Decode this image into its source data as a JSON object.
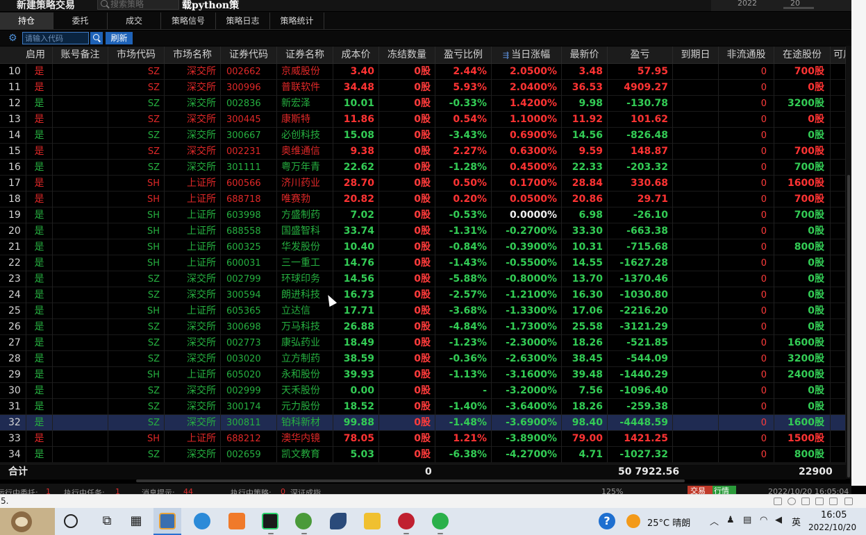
{
  "window": {
    "title": "新建策略交易",
    "search_placeholder": "搜索策略",
    "pane_title": "载python策",
    "date_year": "2022",
    "date_day": "20"
  },
  "tabs": [
    {
      "label": "持仓",
      "active": true
    },
    {
      "label": "委托",
      "active": false
    },
    {
      "label": "成交",
      "active": false
    },
    {
      "label": "策略信号",
      "active": false
    },
    {
      "label": "策略日志",
      "active": false
    },
    {
      "label": "策略统计",
      "active": false
    }
  ],
  "toolbar": {
    "code_placeholder": "请输入代码",
    "refresh_label": "刷新"
  },
  "columns": [
    "启用",
    "账号备注",
    "市场代码",
    "市场名称",
    "证券代码",
    "证券名称",
    "成本价",
    "冻结数量",
    "盈亏比例",
    "当日涨幅",
    "最新价",
    "盈亏",
    "到期日",
    "非流通股",
    "在途股份",
    "可用"
  ],
  "rows": [
    {
      "idx": "10",
      "use": "是",
      "mkt": "SZ",
      "mname": "深交所",
      "code": "002662",
      "name": "京威股份",
      "cost": "3.40",
      "frozen": "0股",
      "pct": "2.44%",
      "chg": "2.0500%",
      "last": "3.48",
      "pnl": "57.95",
      "expire": "",
      "nonc": "0",
      "transit": "700股",
      "dir": "up"
    },
    {
      "idx": "11",
      "use": "是",
      "mkt": "SZ",
      "mname": "深交所",
      "code": "300996",
      "name": "普联软件",
      "cost": "34.48",
      "frozen": "0股",
      "pct": "5.93%",
      "chg": "2.0400%",
      "last": "36.53",
      "pnl": "4909.27",
      "expire": "",
      "nonc": "0",
      "transit": "0股",
      "dir": "up"
    },
    {
      "idx": "12",
      "use": "是",
      "mkt": "SZ",
      "mname": "深交所",
      "code": "002836",
      "name": "新宏泽",
      "cost": "10.01",
      "frozen": "0股",
      "pct": "-0.33%",
      "chg": "1.4200%",
      "last": "9.98",
      "pnl": "-130.78",
      "expire": "",
      "nonc": "0",
      "transit": "3200股",
      "dir": "dn",
      "chgdir": "up"
    },
    {
      "idx": "13",
      "use": "是",
      "mkt": "SZ",
      "mname": "深交所",
      "code": "300445",
      "name": "康斯特",
      "cost": "11.86",
      "frozen": "0股",
      "pct": "0.54%",
      "chg": "1.1000%",
      "last": "11.92",
      "pnl": "101.62",
      "expire": "",
      "nonc": "0",
      "transit": "0股",
      "dir": "up"
    },
    {
      "idx": "14",
      "use": "是",
      "mkt": "SZ",
      "mname": "深交所",
      "code": "300667",
      "name": "必创科技",
      "cost": "15.08",
      "frozen": "0股",
      "pct": "-3.43%",
      "chg": "0.6900%",
      "last": "14.56",
      "pnl": "-826.48",
      "expire": "",
      "nonc": "0",
      "transit": "0股",
      "dir": "dn",
      "chgdir": "up"
    },
    {
      "idx": "15",
      "use": "是",
      "mkt": "SZ",
      "mname": "深交所",
      "code": "002231",
      "name": "奥维通信",
      "cost": "9.38",
      "frozen": "0股",
      "pct": "2.27%",
      "chg": "0.6300%",
      "last": "9.59",
      "pnl": "148.87",
      "expire": "",
      "nonc": "0",
      "transit": "700股",
      "dir": "up"
    },
    {
      "idx": "16",
      "use": "是",
      "mkt": "SZ",
      "mname": "深交所",
      "code": "301111",
      "name": "粤万年青",
      "cost": "22.62",
      "frozen": "0股",
      "pct": "-1.28%",
      "chg": "0.4500%",
      "last": "22.33",
      "pnl": "-203.32",
      "expire": "",
      "nonc": "0",
      "transit": "700股",
      "dir": "dn",
      "chgdir": "up"
    },
    {
      "idx": "17",
      "use": "是",
      "mkt": "SH",
      "mname": "上证所",
      "code": "600566",
      "name": "济川药业",
      "cost": "28.70",
      "frozen": "0股",
      "pct": "0.50%",
      "chg": "0.1700%",
      "last": "28.84",
      "pnl": "330.68",
      "expire": "",
      "nonc": "0",
      "transit": "1600股",
      "dir": "up"
    },
    {
      "idx": "18",
      "use": "是",
      "mkt": "SH",
      "mname": "上证所",
      "code": "688718",
      "name": "唯赛勃",
      "cost": "20.82",
      "frozen": "0股",
      "pct": "0.20%",
      "chg": "0.0500%",
      "last": "20.86",
      "pnl": "29.71",
      "expire": "",
      "nonc": "0",
      "transit": "700股",
      "dir": "up"
    },
    {
      "idx": "19",
      "use": "是",
      "mkt": "SH",
      "mname": "上证所",
      "code": "603998",
      "name": "方盛制药",
      "cost": "7.02",
      "frozen": "0股",
      "pct": "-0.53%",
      "chg": "0.0000%",
      "last": "6.98",
      "pnl": "-26.10",
      "expire": "",
      "nonc": "0",
      "transit": "700股",
      "dir": "dn",
      "chgdir": "flat"
    },
    {
      "idx": "20",
      "use": "是",
      "mkt": "SH",
      "mname": "上证所",
      "code": "688558",
      "name": "国盛智科",
      "cost": "33.74",
      "frozen": "0股",
      "pct": "-1.31%",
      "chg": "-0.2700%",
      "last": "33.30",
      "pnl": "-663.38",
      "expire": "",
      "nonc": "0",
      "transit": "0股",
      "dir": "dn"
    },
    {
      "idx": "21",
      "use": "是",
      "mkt": "SH",
      "mname": "上证所",
      "code": "600325",
      "name": "华发股份",
      "cost": "10.40",
      "frozen": "0股",
      "pct": "-0.84%",
      "chg": "-0.3900%",
      "last": "10.31",
      "pnl": "-715.68",
      "expire": "",
      "nonc": "0",
      "transit": "800股",
      "dir": "dn"
    },
    {
      "idx": "22",
      "use": "是",
      "mkt": "SH",
      "mname": "上证所",
      "code": "600031",
      "name": "三一重工",
      "cost": "14.76",
      "frozen": "0股",
      "pct": "-1.43%",
      "chg": "-0.5500%",
      "last": "14.55",
      "pnl": "-1627.28",
      "expire": "",
      "nonc": "0",
      "transit": "0股",
      "dir": "dn"
    },
    {
      "idx": "23",
      "use": "是",
      "mkt": "SZ",
      "mname": "深交所",
      "code": "002799",
      "name": "环球印务",
      "cost": "14.56",
      "frozen": "0股",
      "pct": "-5.88%",
      "chg": "-0.8000%",
      "last": "13.70",
      "pnl": "-1370.46",
      "expire": "",
      "nonc": "0",
      "transit": "0股",
      "dir": "dn"
    },
    {
      "idx": "24",
      "use": "是",
      "mkt": "SZ",
      "mname": "深交所",
      "code": "300594",
      "name": "朗进科技",
      "cost": "16.73",
      "frozen": "0股",
      "pct": "-2.57%",
      "chg": "-1.2100%",
      "last": "16.30",
      "pnl": "-1030.80",
      "expire": "",
      "nonc": "0",
      "transit": "0股",
      "dir": "dn"
    },
    {
      "idx": "25",
      "use": "是",
      "mkt": "SH",
      "mname": "上证所",
      "code": "605365",
      "name": "立达信",
      "cost": "17.71",
      "frozen": "0股",
      "pct": "-3.68%",
      "chg": "-1.3300%",
      "last": "17.06",
      "pnl": "-2216.20",
      "expire": "",
      "nonc": "0",
      "transit": "0股",
      "dir": "dn"
    },
    {
      "idx": "26",
      "use": "是",
      "mkt": "SZ",
      "mname": "深交所",
      "code": "300698",
      "name": "万马科技",
      "cost": "26.88",
      "frozen": "0股",
      "pct": "-4.84%",
      "chg": "-1.7300%",
      "last": "25.58",
      "pnl": "-3121.29",
      "expire": "",
      "nonc": "0",
      "transit": "0股",
      "dir": "dn"
    },
    {
      "idx": "27",
      "use": "是",
      "mkt": "SZ",
      "mname": "深交所",
      "code": "002773",
      "name": "康弘药业",
      "cost": "18.49",
      "frozen": "0股",
      "pct": "-1.23%",
      "chg": "-2.3000%",
      "last": "18.26",
      "pnl": "-521.85",
      "expire": "",
      "nonc": "0",
      "transit": "1600股",
      "dir": "dn"
    },
    {
      "idx": "28",
      "use": "是",
      "mkt": "SZ",
      "mname": "深交所",
      "code": "003020",
      "name": "立方制药",
      "cost": "38.59",
      "frozen": "0股",
      "pct": "-0.36%",
      "chg": "-2.6300%",
      "last": "38.45",
      "pnl": "-544.09",
      "expire": "",
      "nonc": "0",
      "transit": "3200股",
      "dir": "dn"
    },
    {
      "idx": "29",
      "use": "是",
      "mkt": "SH",
      "mname": "上证所",
      "code": "605020",
      "name": "永和股份",
      "cost": "39.93",
      "frozen": "0股",
      "pct": "-1.13%",
      "chg": "-3.1600%",
      "last": "39.48",
      "pnl": "-1440.29",
      "expire": "",
      "nonc": "0",
      "transit": "2400股",
      "dir": "dn"
    },
    {
      "idx": "30",
      "use": "是",
      "mkt": "SZ",
      "mname": "深交所",
      "code": "002999",
      "name": "天禾股份",
      "cost": "0.00",
      "frozen": "0股",
      "pct": "-",
      "chg": "-3.2000%",
      "last": "7.56",
      "pnl": "-1096.40",
      "expire": "",
      "nonc": "0",
      "transit": "0股",
      "dir": "dn"
    },
    {
      "idx": "31",
      "use": "是",
      "mkt": "SZ",
      "mname": "深交所",
      "code": "300174",
      "name": "元力股份",
      "cost": "18.52",
      "frozen": "0股",
      "pct": "-1.40%",
      "chg": "-3.6400%",
      "last": "18.26",
      "pnl": "-259.38",
      "expire": "",
      "nonc": "0",
      "transit": "0股",
      "dir": "dn"
    },
    {
      "idx": "32",
      "use": "是",
      "mkt": "SZ",
      "mname": "深交所",
      "code": "300811",
      "name": "铂科新材",
      "cost": "99.88",
      "frozen": "0股",
      "pct": "-1.48%",
      "chg": "-3.6900%",
      "last": "98.40",
      "pnl": "-4448.59",
      "expire": "",
      "nonc": "0",
      "transit": "1600股",
      "dir": "dn",
      "selected": true
    },
    {
      "idx": "33",
      "use": "是",
      "mkt": "SH",
      "mname": "上证所",
      "code": "688212",
      "name": "澳华内镜",
      "cost": "78.05",
      "frozen": "0股",
      "pct": "1.21%",
      "chg": "-3.8900%",
      "last": "79.00",
      "pnl": "1421.25",
      "expire": "",
      "nonc": "0",
      "transit": "1500股",
      "dir": "up",
      "chgdir": "dn"
    },
    {
      "idx": "34",
      "use": "是",
      "mkt": "SZ",
      "mname": "深交所",
      "code": "002659",
      "name": "凯文教育",
      "cost": "5.03",
      "frozen": "0股",
      "pct": "-6.38%",
      "chg": "-4.2700%",
      "last": "4.71",
      "pnl": "-1027.32",
      "expire": "",
      "nonc": "0",
      "transit": "800股",
      "dir": "dn"
    }
  ],
  "totals": {
    "label": "合计",
    "frozen": "0",
    "pnl": "50 7922.56",
    "transit": "22900"
  },
  "statusbar": {
    "orders_label": "运行中委托:",
    "orders_value": "1",
    "tasks_label": "执行中任务:",
    "tasks_value": "1",
    "msg_label": "消息提示:",
    "msg_value": "44",
    "strat_label": "执行中策略:",
    "strat_value": "0",
    "index_label": "深证成指",
    "zoom": "125%",
    "trade_label": "交易",
    "quote_label": "行情",
    "datetime": "2022/10/20 16:05:04"
  },
  "taskbar": {
    "weather": "25°C 晴朗",
    "ime": "英",
    "time": "16:05",
    "date": "2022/10/20"
  },
  "colors": {
    "up": "#ff3333",
    "down": "#33cc55",
    "accent": "#1f63b8",
    "selected_row": "#1f2b52"
  }
}
